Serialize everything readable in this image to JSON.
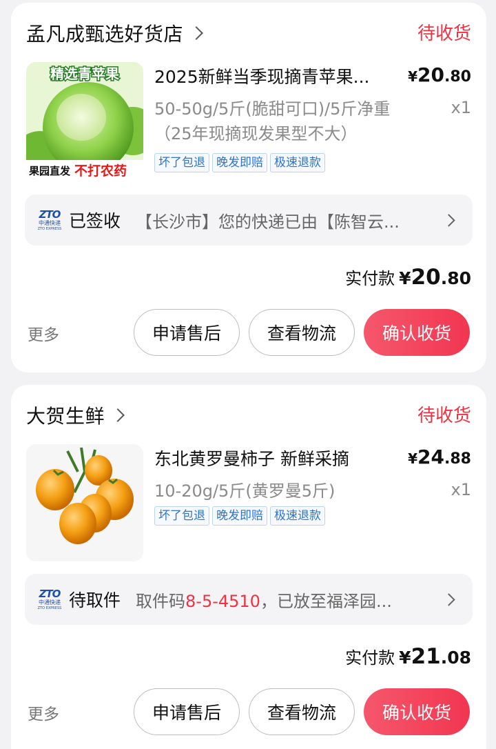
{
  "orders": [
    {
      "shop_name": "孟凡成甄选好货店",
      "status": "待收货",
      "product": {
        "title": "2025新鲜当季现摘青苹果...",
        "price_currency": "¥",
        "price_int": "20",
        "price_dec": ".80",
        "spec_line1": "50-50g/5斤(脆甜可口)/5斤净重",
        "spec_line2": "（25年现摘现发果型不大）",
        "qty": "x1",
        "image_banner_top": "精选青苹果",
        "image_banner_bottom_left": "果园直发",
        "image_banner_bottom_right": "不打农药"
      },
      "tags": [
        "坏了包退",
        "晚发即赔",
        "极速退款"
      ],
      "logistics": {
        "carrier_logo_text": "ZTO",
        "carrier_logo_cn": "中通快递",
        "carrier_logo_en": "ZTO EXPRESS",
        "status": "已签收",
        "message": "【长沙市】您的快递已由【陈智云..."
      },
      "payment": {
        "label": "实付款",
        "currency": "¥",
        "int": "20",
        "dec": ".80"
      },
      "actions": {
        "more": "更多",
        "after_sales": "申请售后",
        "track": "查看物流",
        "confirm": "确认收货"
      }
    },
    {
      "shop_name": "大贺生鲜",
      "status": "待收货",
      "product": {
        "title": "东北黄罗曼柿子 新鲜采摘",
        "price_currency": "¥",
        "price_int": "24",
        "price_dec": ".88",
        "spec_line1": "10-20g/5斤(黄罗曼5斤)",
        "spec_line2": "",
        "qty": "x1"
      },
      "tags": [
        "坏了包退",
        "晚发即赔",
        "极速退款"
      ],
      "logistics": {
        "carrier_logo_text": "ZTO",
        "carrier_logo_cn": "中通快递",
        "carrier_logo_en": "ZTO EXPRESS",
        "status": "待取件",
        "message_prefix": "取件码",
        "pickup_code": "8-5-4510",
        "message_suffix": "，已放至福泽园..."
      },
      "payment": {
        "label": "实付款",
        "currency": "¥",
        "int": "21",
        "dec": ".08"
      },
      "actions": {
        "more": "更多",
        "after_sales": "申请售后",
        "track": "查看物流",
        "confirm": "确认收货"
      }
    }
  ],
  "colors": {
    "accent": "#f23041",
    "tag_blue": "#2e74c9",
    "bg": "#f2f2f4"
  }
}
